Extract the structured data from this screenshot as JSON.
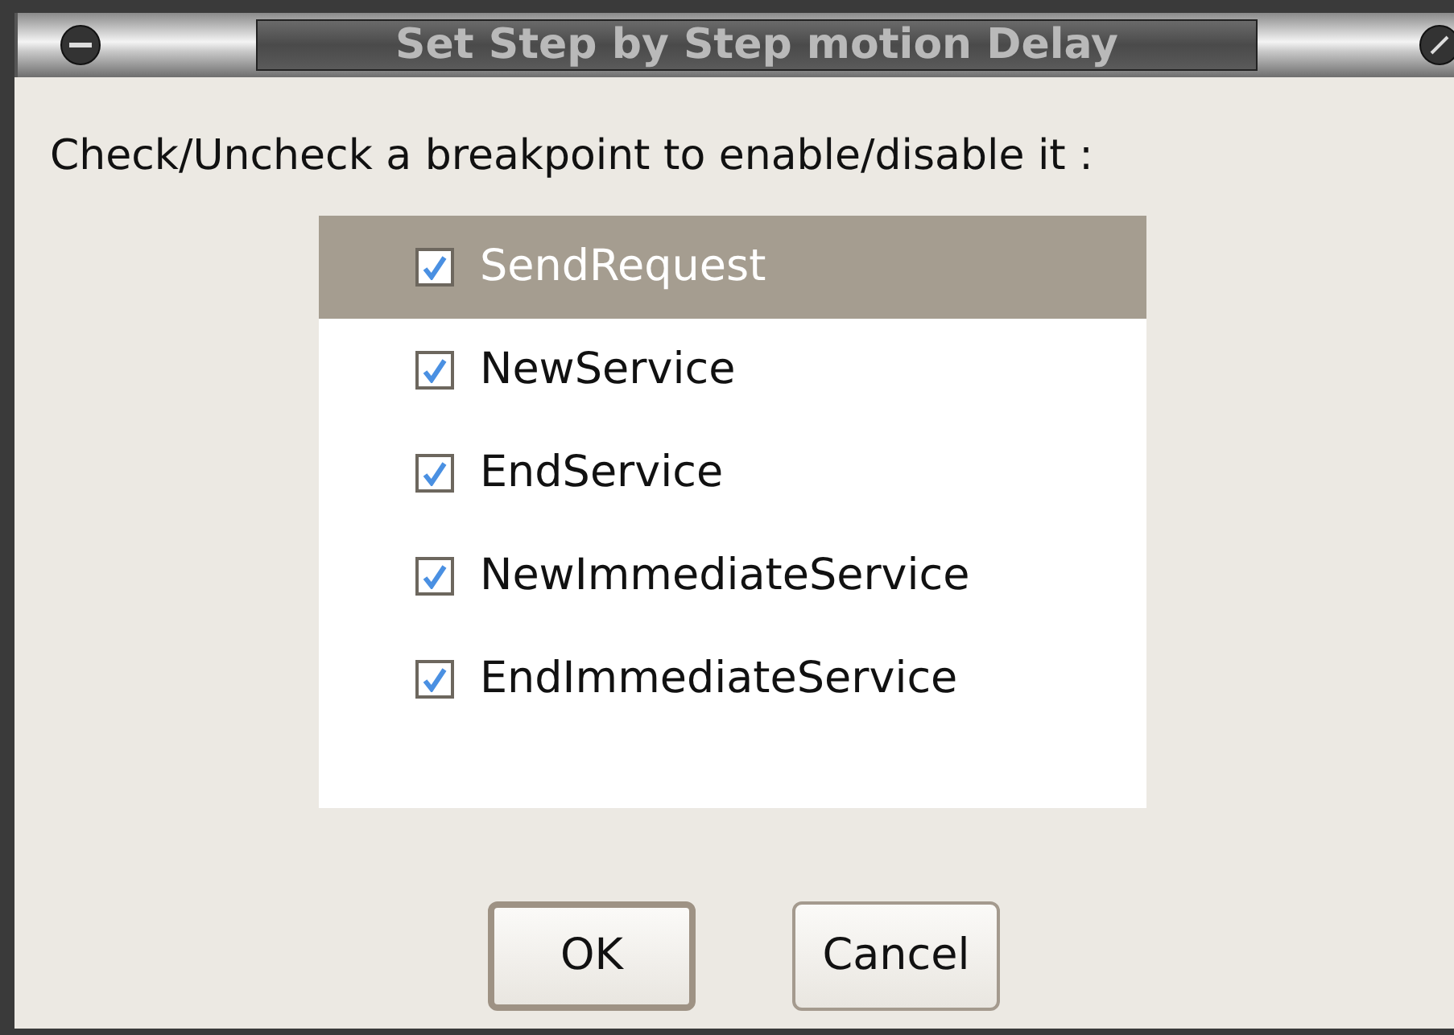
{
  "window": {
    "title": "Set Step by Step motion Delay"
  },
  "instruction": "Check/Uncheck a breakpoint to enable/disable it :",
  "breakpoints": [
    {
      "label": "SendRequest",
      "checked": true,
      "selected": true
    },
    {
      "label": "NewService",
      "checked": true,
      "selected": false
    },
    {
      "label": "EndService",
      "checked": true,
      "selected": false
    },
    {
      "label": "NewImmediateService",
      "checked": true,
      "selected": false
    },
    {
      "label": "EndImmediateService",
      "checked": true,
      "selected": false
    }
  ],
  "buttons": [
    {
      "label": "OK",
      "default": true
    },
    {
      "label": "Cancel",
      "default": false
    }
  ]
}
